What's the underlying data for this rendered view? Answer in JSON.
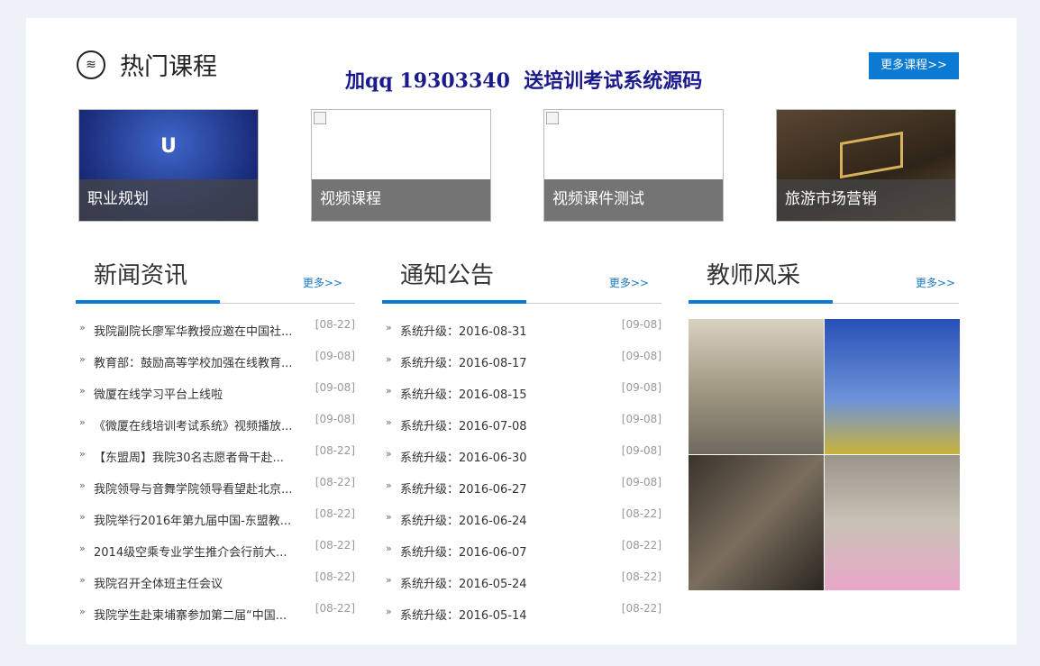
{
  "hot": {
    "title": "热门课程",
    "icon": "layers-icon",
    "promo": "加qq 19303340  送培训考试系统源码",
    "more": "更多课程>>",
    "courses": [
      {
        "label": "职业规划"
      },
      {
        "label": "视频课程"
      },
      {
        "label": "视频课件测试"
      },
      {
        "label": "旅游市场营销"
      }
    ]
  },
  "news": {
    "title": "新闻资讯",
    "more": "更多>>",
    "items": [
      {
        "t": "我院副院长廖军华教授应邀在中国社...",
        "d": "[08-22]"
      },
      {
        "t": "教育部：鼓励高等学校加强在线教育...",
        "d": "[09-08]"
      },
      {
        "t": "微厦在线学习平台上线啦",
        "d": "[09-08]"
      },
      {
        "t": "《微厦在线培训考试系统》视频播放...",
        "d": "[09-08]"
      },
      {
        "t": "【东盟周】我院30名志愿者骨干赴...",
        "d": "[08-22]"
      },
      {
        "t": "我院领导与音舞学院领导看望赴北京...",
        "d": "[08-22]"
      },
      {
        "t": "我院举行2016年第九届中国-东盟教...",
        "d": "[08-22]"
      },
      {
        "t": "2014级空乘专业学生推介会行前大...",
        "d": "[08-22]"
      },
      {
        "t": "我院召开全体班主任会议",
        "d": "[08-22]"
      },
      {
        "t": "我院学生赴柬埔寨参加第二届“中国...",
        "d": "[08-22]"
      }
    ]
  },
  "notice": {
    "title": "通知公告",
    "more": "更多>>",
    "items": [
      {
        "t": "系统升级：2016-08-31",
        "d": "[09-08]"
      },
      {
        "t": "系统升级：2016-08-17",
        "d": "[09-08]"
      },
      {
        "t": "系统升级：2016-08-15",
        "d": "[09-08]"
      },
      {
        "t": "系统升级：2016-07-08",
        "d": "[09-08]"
      },
      {
        "t": "系统升级：2016-06-30",
        "d": "[09-08]"
      },
      {
        "t": "系统升级：2016-06-27",
        "d": "[09-08]"
      },
      {
        "t": "系统升级：2016-06-24",
        "d": "[08-22]"
      },
      {
        "t": "系统升级：2016-06-07",
        "d": "[08-22]"
      },
      {
        "t": "系统升级：2016-05-24",
        "d": "[08-22]"
      },
      {
        "t": "系统升级：2016-05-14",
        "d": "[08-22]"
      }
    ]
  },
  "teachers": {
    "title": "教师风采",
    "more": "更多>>"
  }
}
